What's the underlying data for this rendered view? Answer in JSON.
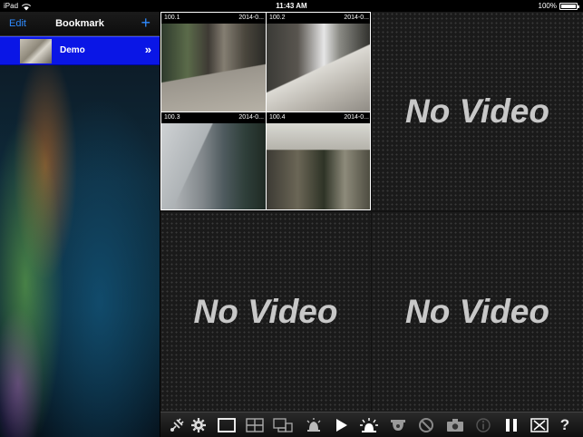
{
  "status_bar": {
    "device": "iPad",
    "time": "11:43 AM",
    "battery_percent": "100%"
  },
  "sidebar": {
    "edit_label": "Edit",
    "title": "Bookmark",
    "add_label": "+",
    "bookmarks": [
      {
        "label": "Demo",
        "chevron": "»"
      }
    ]
  },
  "video_grid": {
    "cameras": [
      {
        "name": "100.1",
        "date": "2014-0..."
      },
      {
        "name": "100.2",
        "date": "2014-0..."
      },
      {
        "name": "100.3",
        "date": "2014-0..."
      },
      {
        "name": "100.4",
        "date": "2014-0..."
      }
    ],
    "empty_tiles": [
      {
        "label": "No Video"
      },
      {
        "label": "No Video"
      },
      {
        "label": "No Video"
      }
    ]
  },
  "toolbar": {
    "buttons": [
      "satellite-icon",
      "gear-icon",
      "single-view-icon",
      "quad-view-icon",
      "multi-view-icon",
      "alarm-bell-icon",
      "play-icon",
      "siren-icon",
      "dome-camera-icon",
      "no-entry-icon",
      "camera-icon",
      "info-icon",
      "pause-icon",
      "close-box-icon",
      "help-icon"
    ],
    "help_label": "?"
  }
}
